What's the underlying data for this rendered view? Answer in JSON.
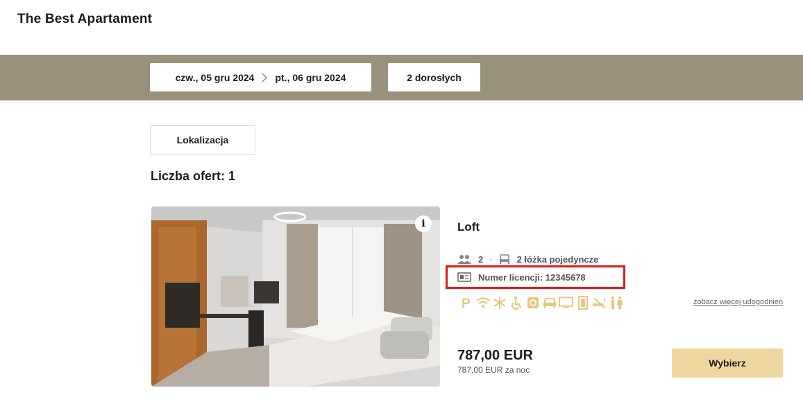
{
  "header": {
    "title": "The Best Apartament"
  },
  "search": {
    "check_in": "czw., 05 gru 2024",
    "check_out": "pt., 06 gru 2024",
    "guests": "2 dorosłych"
  },
  "filters": {
    "location_label": "Lokalizacja"
  },
  "results": {
    "count_label": "Liczba ofert: 1"
  },
  "offer": {
    "name": "Loft",
    "guests": "2",
    "beds": "2 łóżka pojedyncze",
    "license": "Numer licencji: 12345678",
    "info_label": "i",
    "amenities": [
      "parking-icon",
      "wifi-icon",
      "air-conditioning-icon",
      "accessible-icon",
      "coffee-icon",
      "sofa-icon",
      "tv-icon",
      "door-icon",
      "no-smoking-icon",
      "restroom-icon"
    ],
    "more_amenities": "zobacz więcej udogodnień",
    "price": "787,00 EUR",
    "price_per_night": "787,00 EUR za noc",
    "select_label": "Wybierz"
  },
  "colors": {
    "search_bar": "#9a917d",
    "accent": "#eed79e",
    "amenity": "#e6c77a",
    "highlight": "#e3161b"
  }
}
